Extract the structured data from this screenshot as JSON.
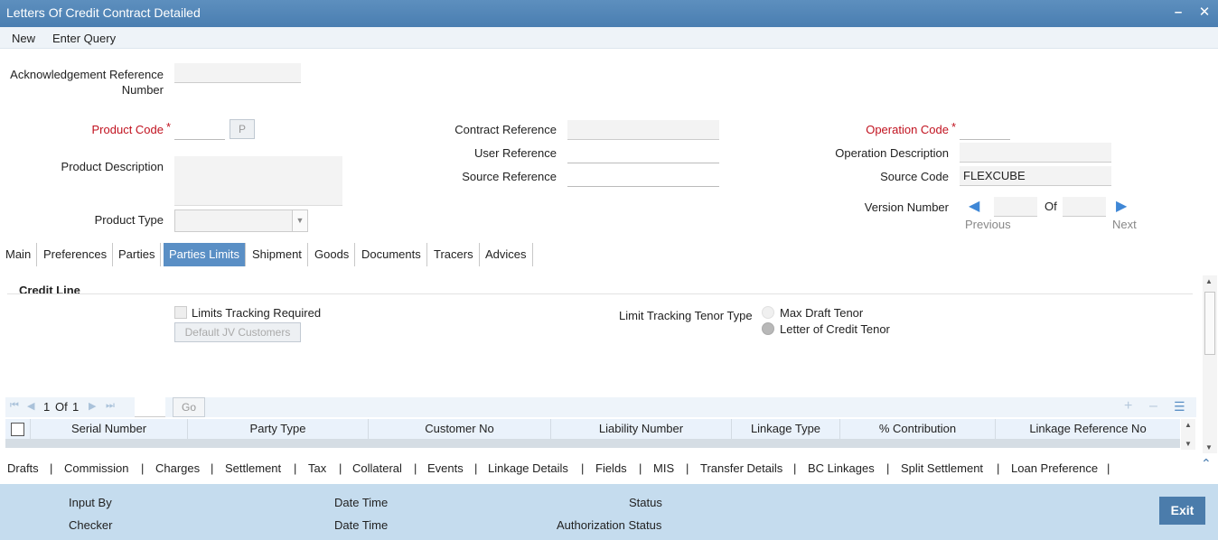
{
  "window": {
    "title": "Letters Of Credit Contract Detailed"
  },
  "menu": {
    "new": "New",
    "enter_query": "Enter Query"
  },
  "form": {
    "ack_ref_label": "Acknowledgement Reference",
    "ack_ref_label2": "Number",
    "product_code_label": "Product Code",
    "required_mark": "*",
    "p_button": "P",
    "product_description_label": "Product Description",
    "product_type_label": "Product Type",
    "contract_reference_label": "Contract Reference",
    "user_reference_label": "User Reference",
    "source_reference_label": "Source Reference",
    "operation_code_label": "Operation Code",
    "operation_description_label": "Operation Description",
    "source_code_label": "Source Code",
    "source_code_value": "FLEXCUBE",
    "version_number_label": "Version Number",
    "of": "Of",
    "previous": "Previous",
    "next": "Next"
  },
  "tabs": [
    "Main",
    "Preferences",
    "Parties",
    "Parties Limits",
    "Shipment",
    "Goods",
    "Documents",
    "Tracers",
    "Advices"
  ],
  "credit_line": {
    "heading": "Credit Line",
    "limits_tracking_required": "Limits Tracking Required",
    "default_jv_customers": "Default JV Customers",
    "tenor_type_label": "Limit Tracking Tenor Type",
    "max_draft_tenor": "Max Draft Tenor",
    "letter_of_credit_tenor": "Letter of Credit Tenor"
  },
  "grid": {
    "page": "1",
    "of": "Of",
    "total": "1",
    "go": "Go",
    "columns": [
      "Serial Number",
      "Party Type",
      "Customer No",
      "Liability Number",
      "Linkage Type",
      "% Contribution",
      "Linkage Reference No"
    ]
  },
  "bottom_links": [
    "Drafts",
    "Commission",
    "Charges",
    "Settlement",
    "Tax",
    "Collateral",
    "Events",
    "Linkage Details",
    "Fields",
    "MIS",
    "Transfer Details",
    "BC Linkages",
    "Split Settlement",
    "Loan Preference"
  ],
  "footer": {
    "input_by": "Input By",
    "checker": "Checker",
    "date_time": "Date Time",
    "status": "Status",
    "authorization_status": "Authorization Status",
    "exit": "Exit"
  }
}
